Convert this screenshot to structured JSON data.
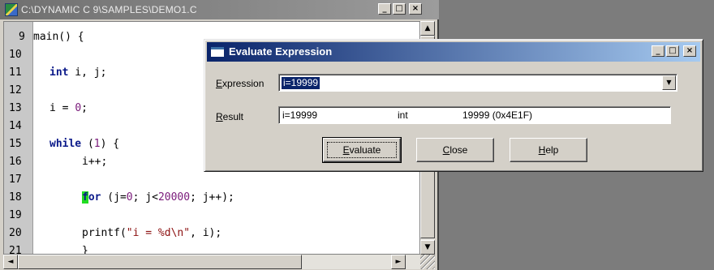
{
  "editor": {
    "title": "C:\\DYNAMIC C 9\\SAMPLES\\DEMO1.C",
    "controls": {
      "minimize": "_",
      "maximize": "□",
      "close": "×"
    },
    "lines": [
      {
        "num": "9",
        "code": "main() {"
      },
      {
        "num": "10",
        "code": ""
      },
      {
        "num": "11",
        "kw": "int",
        "rest": " i, j;"
      },
      {
        "num": "12",
        "code": ""
      },
      {
        "num": "13",
        "pre": "i = ",
        "numv": "0",
        "post": ";"
      },
      {
        "num": "14",
        "code": ""
      },
      {
        "num": "15",
        "kw": "while",
        "pre": " (",
        "numv": "1",
        "post": ") {"
      },
      {
        "num": "16",
        "code": "i++;"
      },
      {
        "num": "17",
        "code": ""
      },
      {
        "num": "18",
        "kwhl": "f",
        "kwrest": "or",
        "pre": " (j=",
        "numv": "0",
        "mid": "; j<",
        "numv2": "20000",
        "post": "; j++);"
      },
      {
        "num": "19",
        "code": ""
      },
      {
        "num": "20",
        "pre": "printf(",
        "str": "\"i = %d\\n\"",
        "post": ", i);"
      },
      {
        "num": "21",
        "code": "}"
      }
    ],
    "scroll_up": "▲",
    "scroll_down": "▼",
    "scroll_left": "◄",
    "scroll_right": "►"
  },
  "dialog": {
    "title": "Evaluate Expression",
    "controls": {
      "minimize": "_",
      "maximize": "□",
      "close": "×"
    },
    "expression": {
      "label_u": "E",
      "label_rest": "xpression",
      "value": "i=19999",
      "dropdown": "▼"
    },
    "result": {
      "label_u": "R",
      "label_rest": "esult",
      "name": "i=19999",
      "type": "int",
      "value": "19999 (0x4E1F)"
    },
    "buttons": {
      "evaluate": {
        "u": "E",
        "rest": "valuate"
      },
      "close": {
        "u": "C",
        "rest": "lose"
      },
      "help": {
        "u": "H",
        "rest": "elp"
      }
    }
  }
}
